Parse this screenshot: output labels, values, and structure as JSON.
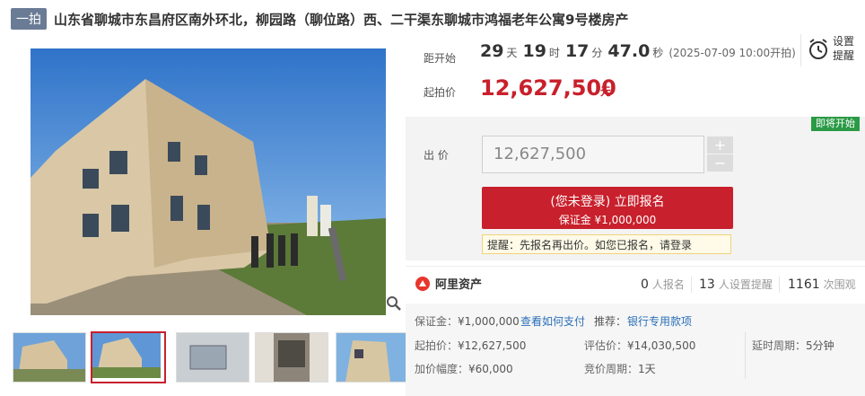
{
  "header": {
    "tag": "一拍",
    "title": "山东省聊城市东昌府区南外环北，柳园路（聊位路）西、二干渠东聊城市鸿福老年公寓9号楼房产"
  },
  "countdown": {
    "label": "距开始",
    "days": "29",
    "days_unit": "天",
    "hours": "19",
    "hours_unit": "时",
    "minutes": "17",
    "minutes_unit": "分",
    "seconds": "47.0",
    "seconds_unit": "秒",
    "start_text": "(2025-07-09 10:00开拍)"
  },
  "start_price": {
    "label": "起拍价",
    "value": "12,627,500",
    "unit": "元"
  },
  "remind": {
    "label": "设置提醒",
    "icon": "alarm-clock-icon"
  },
  "bid": {
    "status_badge": "即将开始",
    "label": "出 价",
    "input_value": "12,627,500",
    "plus": "+",
    "minus": "−",
    "cta_main": "(您未登录) 立即报名",
    "cta_sub": "保证金 ¥1,000,000",
    "tip_prefix": "提醒：先报名再出价。如您已报名，请",
    "tip_link": "登录"
  },
  "provider": {
    "name": "阿里资产",
    "signups": "0",
    "signups_label": "人报名",
    "reminders": "13",
    "reminders_label": "人设置提醒",
    "views": "1161",
    "views_label": "次围观"
  },
  "details": {
    "deposit_label": "保证金：",
    "deposit_value": "¥1,000,000",
    "pay_link": "查看如何支付",
    "recommend_label": "推荐：",
    "recommend_link": "银行专用款项",
    "start_price_label": "起拍价：",
    "start_price_value": "¥12,627,500",
    "appraisal_label": "评估价：",
    "appraisal_value": "¥14,030,500",
    "delay_label": "延时周期：",
    "delay_value": "5分钟",
    "increment_label": "加价幅度：",
    "increment_value": "¥60,000",
    "cycle_label": "竞价周期：",
    "cycle_value": "1天"
  },
  "colors": {
    "accent": "#c8202c",
    "badge": "#2a9a45",
    "link": "#2a6fb8"
  }
}
